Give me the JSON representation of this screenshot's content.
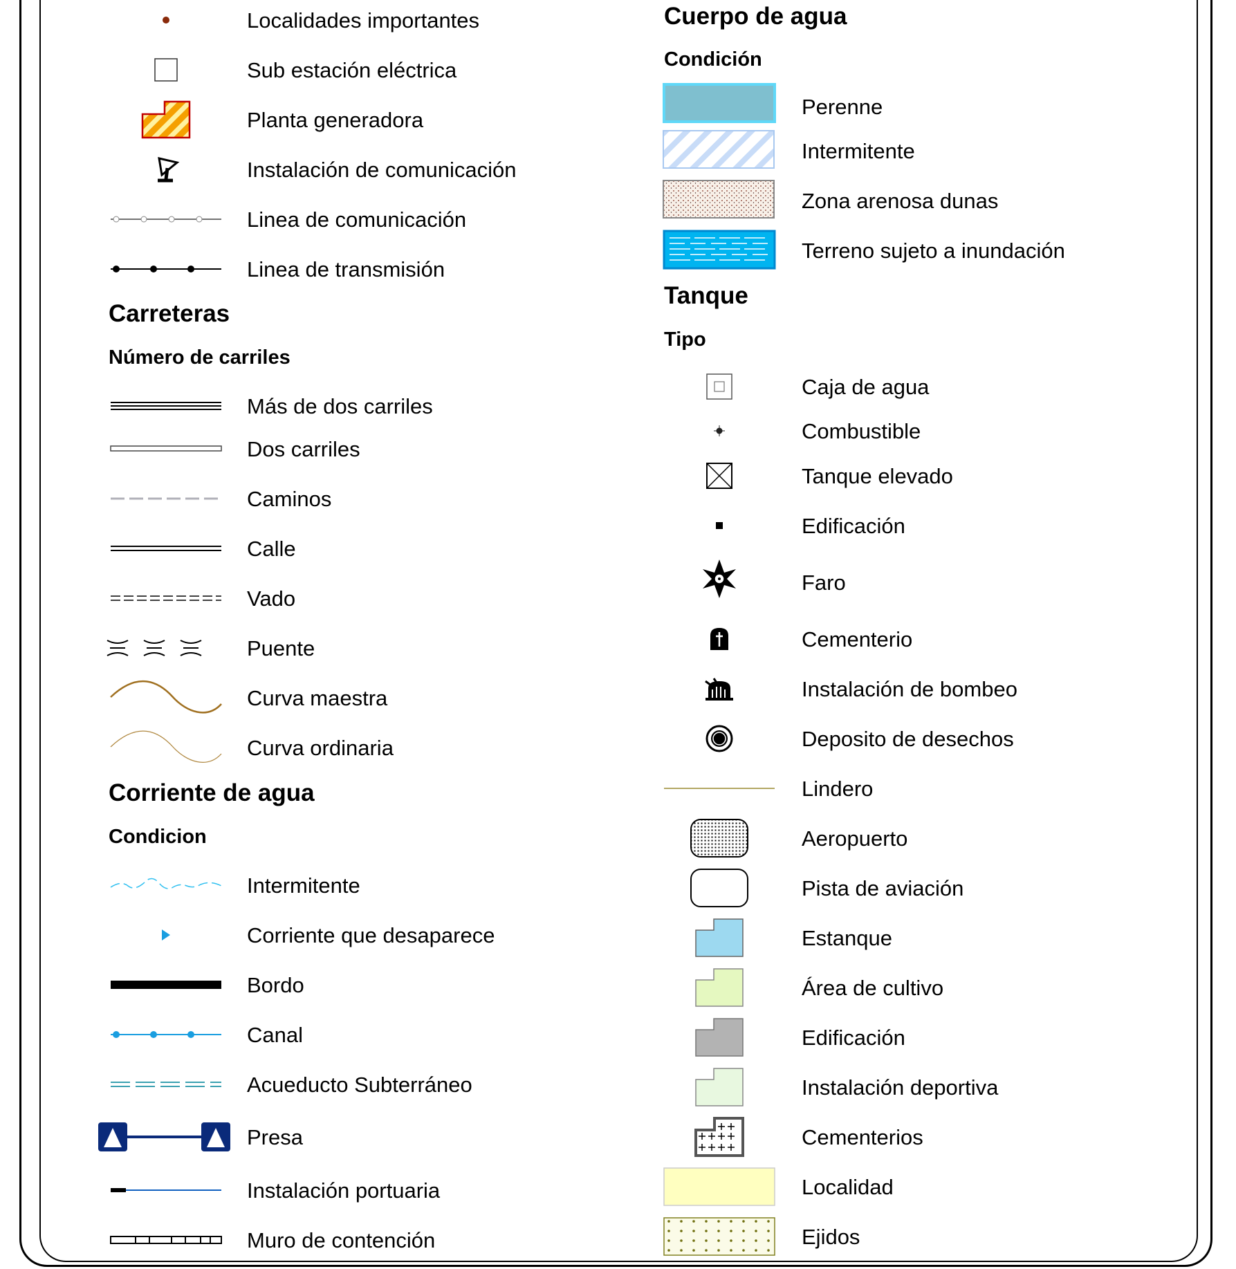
{
  "left": {
    "items_top": [
      {
        "label": "Localidades importantes",
        "symbol": "dot-icon"
      },
      {
        "label": "Sub estación eléctrica",
        "symbol": "square-icon"
      },
      {
        "label": "Planta generadora",
        "symbol": "power-plant-icon"
      },
      {
        "label": "Instalación de comunicación",
        "symbol": "antenna-icon"
      },
      {
        "label": "Linea de comunicación",
        "symbol": "comm-line-icon"
      },
      {
        "label": "Linea de transmisión",
        "symbol": "transmission-line-icon"
      }
    ],
    "roads": {
      "title": "Carreteras",
      "subtitle": "Número de carriles",
      "items": [
        {
          "label": "Más de dos carriles",
          "symbol": "multi-lane-icon"
        },
        {
          "label": "Dos carriles",
          "symbol": "two-lane-icon"
        },
        {
          "label": "Caminos",
          "symbol": "path-icon"
        },
        {
          "label": "Calle",
          "symbol": "street-icon"
        },
        {
          "label": "Vado",
          "symbol": "ford-icon"
        },
        {
          "label": "Puente",
          "symbol": "bridge-icon"
        },
        {
          "label": "Curva maestra",
          "symbol": "index-contour-icon"
        },
        {
          "label": "Curva ordinaria",
          "symbol": "ordinary-contour-icon"
        }
      ]
    },
    "water": {
      "title": "Corriente de agua",
      "subtitle": "Condicion",
      "items": [
        {
          "label": "Intermitente",
          "symbol": "intermittent-stream-icon"
        },
        {
          "label": "Corriente que desaparece",
          "symbol": "disappearing-stream-icon"
        },
        {
          "label": "Bordo",
          "symbol": "levee-icon"
        },
        {
          "label": "Canal",
          "symbol": "canal-icon"
        },
        {
          "label": "Acueducto Subterráneo",
          "symbol": "aqueduct-icon"
        },
        {
          "label": "Presa",
          "symbol": "dam-icon"
        },
        {
          "label": "Instalación portuaria",
          "symbol": "port-icon"
        },
        {
          "label": "Muro de contención",
          "symbol": "retaining-wall-icon"
        }
      ]
    }
  },
  "right": {
    "body": {
      "title": "Cuerpo de agua",
      "subtitle": "Condición",
      "items": [
        {
          "label": "Perenne",
          "symbol": "perennial-icon"
        },
        {
          "label": "Intermitente",
          "symbol": "intermittent-body-icon"
        },
        {
          "label": "Zona arenosa dunas",
          "symbol": "dunes-icon"
        },
        {
          "label": "Terreno sujeto a inundación",
          "symbol": "flood-icon"
        }
      ]
    },
    "tank": {
      "title": "Tanque",
      "subtitle": "Tipo",
      "items": [
        {
          "label": "Caja de agua",
          "symbol": "water-box-icon"
        },
        {
          "label": "Combustible",
          "symbol": "fuel-icon"
        },
        {
          "label": "Tanque elevado",
          "symbol": "elevated-tank-icon"
        },
        {
          "label": "Edificación",
          "symbol": "building-dot-icon"
        },
        {
          "label": "Faro",
          "symbol": "lighthouse-icon"
        },
        {
          "label": "Cementerio",
          "symbol": "cemetery-icon"
        },
        {
          "label": "Instalación de bombeo",
          "symbol": "pump-icon"
        },
        {
          "label": "Deposito de desechos",
          "symbol": "waste-icon"
        },
        {
          "label": "Lindero",
          "symbol": "boundary-icon"
        },
        {
          "label": "Aeropuerto",
          "symbol": "airport-icon"
        },
        {
          "label": "Pista de aviación",
          "symbol": "airstrip-icon"
        },
        {
          "label": "Estanque",
          "symbol": "pond-icon"
        },
        {
          "label": "Área de cultivo",
          "symbol": "crop-icon"
        },
        {
          "label": "Edificación",
          "symbol": "building-area-icon"
        },
        {
          "label": "Instalación deportiva",
          "symbol": "sports-icon"
        },
        {
          "label": "Cementerios",
          "symbol": "cemeteries-icon"
        },
        {
          "label": "Localidad",
          "symbol": "locality-icon"
        },
        {
          "label": "Ejidos",
          "symbol": "ejido-icon"
        }
      ]
    }
  },
  "colors": {
    "water_cyan": "#00b4f0",
    "perennial_fill": "#7fbfcf",
    "pond_fill": "#9dd9f0",
    "crop_fill": "#e5f8c0",
    "building_fill": "#b3b3b3",
    "sports_fill": "#e8f8e0",
    "locality_fill": "#ffffc0",
    "contour_brown": "#a07020",
    "dam_blue": "#0a2a7a",
    "port_blue": "#1060c0"
  }
}
